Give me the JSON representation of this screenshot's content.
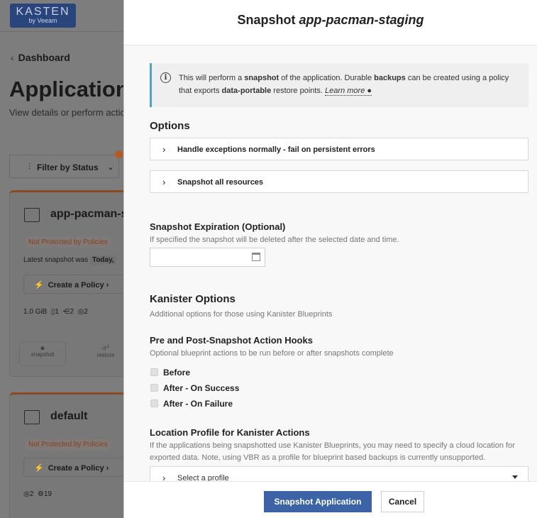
{
  "background": {
    "logo": {
      "brand": "KASTEN",
      "sub": "by Veeam"
    },
    "breadcrumb": "Dashboard",
    "title": "Applications",
    "subtitle": "View details or perform actions",
    "filter_label": "Filter by Status",
    "apps": [
      {
        "name": "app-pacman-staging",
        "badge": "Not Protected by Policies",
        "latest_label": "Latest snapshot was",
        "latest_value": "Today,",
        "create_policy": "Create a Policy",
        "size": "1.0 GiB",
        "volumes": "1",
        "workloads": "2",
        "resources": "2",
        "actions": {
          "snapshot": "snapshot",
          "restore": "restore",
          "restore_count": "1"
        }
      },
      {
        "name": "default",
        "badge": "Not Protected by Policies",
        "create_policy": "Create a Policy",
        "resources": "2",
        "other": "19"
      }
    ]
  },
  "modal": {
    "title_prefix": "Snapshot",
    "title_app": "app-pacman-staging",
    "info": {
      "t1": "This will perform a ",
      "b1": "snapshot",
      "t2": " of the application. Durable ",
      "b2": "backups",
      "t3": " can be created using a policy that exports ",
      "b3": "data-portable",
      "t4": " restore points. ",
      "link": "Learn more"
    },
    "options_heading": "Options",
    "options": [
      "Handle exceptions normally - fail on persistent errors",
      "Snapshot all resources"
    ],
    "expiration": {
      "label": "Snapshot Expiration (Optional)",
      "help": "If specified the snapshot will be deleted after the selected date and time.",
      "value": ""
    },
    "kanister": {
      "heading": "Kanister Options",
      "help": "Additional options for those using Kanister Blueprints",
      "hooks_label": "Pre and Post-Snapshot Action Hooks",
      "hooks_help": "Optional blueprint actions to be run before or after snapshots complete",
      "hooks": [
        "Before",
        "After - On Success",
        "After - On Failure"
      ],
      "location_label": "Location Profile for Kanister Actions",
      "location_help": "If the applications being snapshotted use Kanister Blueprints, you may need to specify a cloud location for exported data. Note, using VBR as a profile for blueprint based backups is currently unsupported.",
      "profile_placeholder": "Select a profile"
    },
    "buttons": {
      "primary": "Snapshot Application",
      "cancel": "Cancel"
    }
  },
  "colors": {
    "primary": "#3b63a6",
    "info_border": "#4fa3c4",
    "warning": "#b55a23"
  }
}
